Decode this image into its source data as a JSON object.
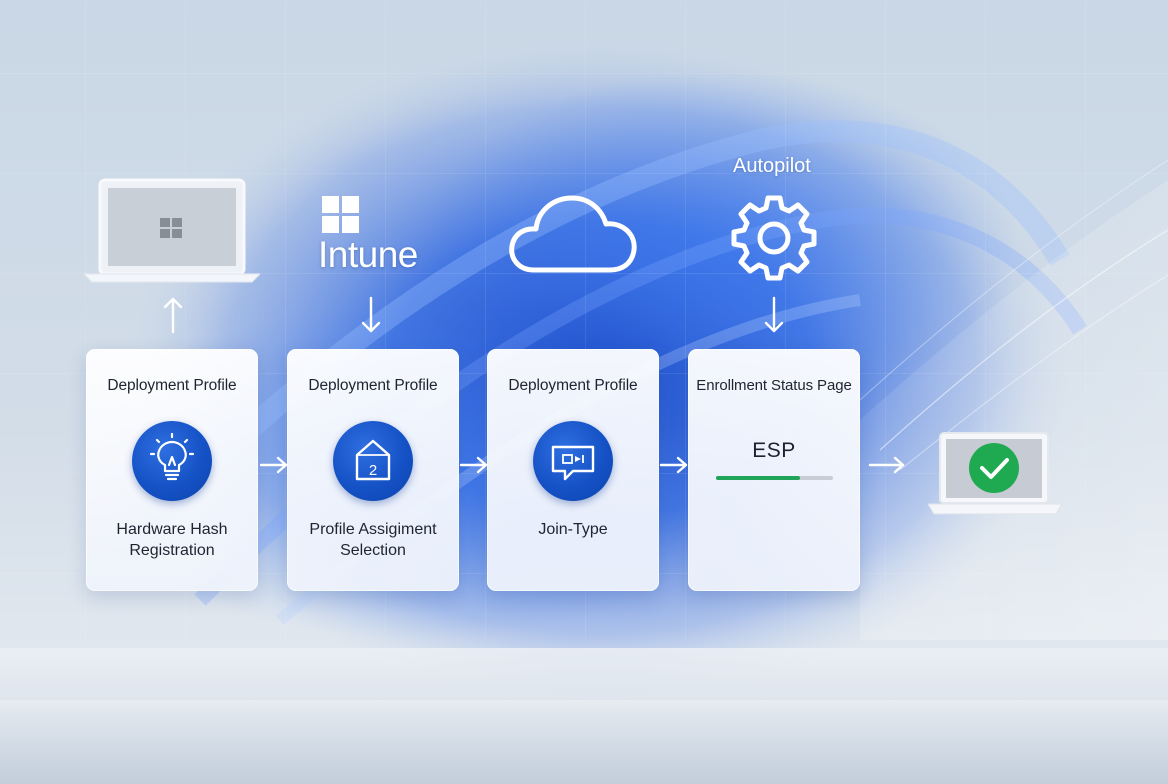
{
  "top": {
    "intune_label": "Intune",
    "autopilot_label": "Autopilot"
  },
  "cards": [
    {
      "title": "Deployment Profile",
      "icon": "lightbulb-icon",
      "subtitle_line1": "Hardware Hash",
      "subtitle_line2": "Registration"
    },
    {
      "title": "Deployment Profile",
      "icon": "numbered-box-icon",
      "icon_glyph": "2",
      "subtitle_line1": "Profile Assigiment",
      "subtitle_line2": "Selection"
    },
    {
      "title": "Deployment Profile",
      "icon": "chat-bubble-icon",
      "subtitle_line1": "Join-Type",
      "subtitle_line2": ""
    },
    {
      "title": "Enrollment Status Page",
      "esp_label": "ESP",
      "progress_fraction": 0.72
    }
  ],
  "colors": {
    "accent_blue": "#1552c6",
    "progress_green": "#1fa45a",
    "success_green": "#1faa52"
  },
  "icons": [
    "laptop-icon",
    "windows-logo-icon",
    "cloud-icon",
    "gear-icon",
    "arrow-up-icon",
    "arrow-down-icon",
    "arrow-right-icon",
    "laptop-check-icon"
  ]
}
